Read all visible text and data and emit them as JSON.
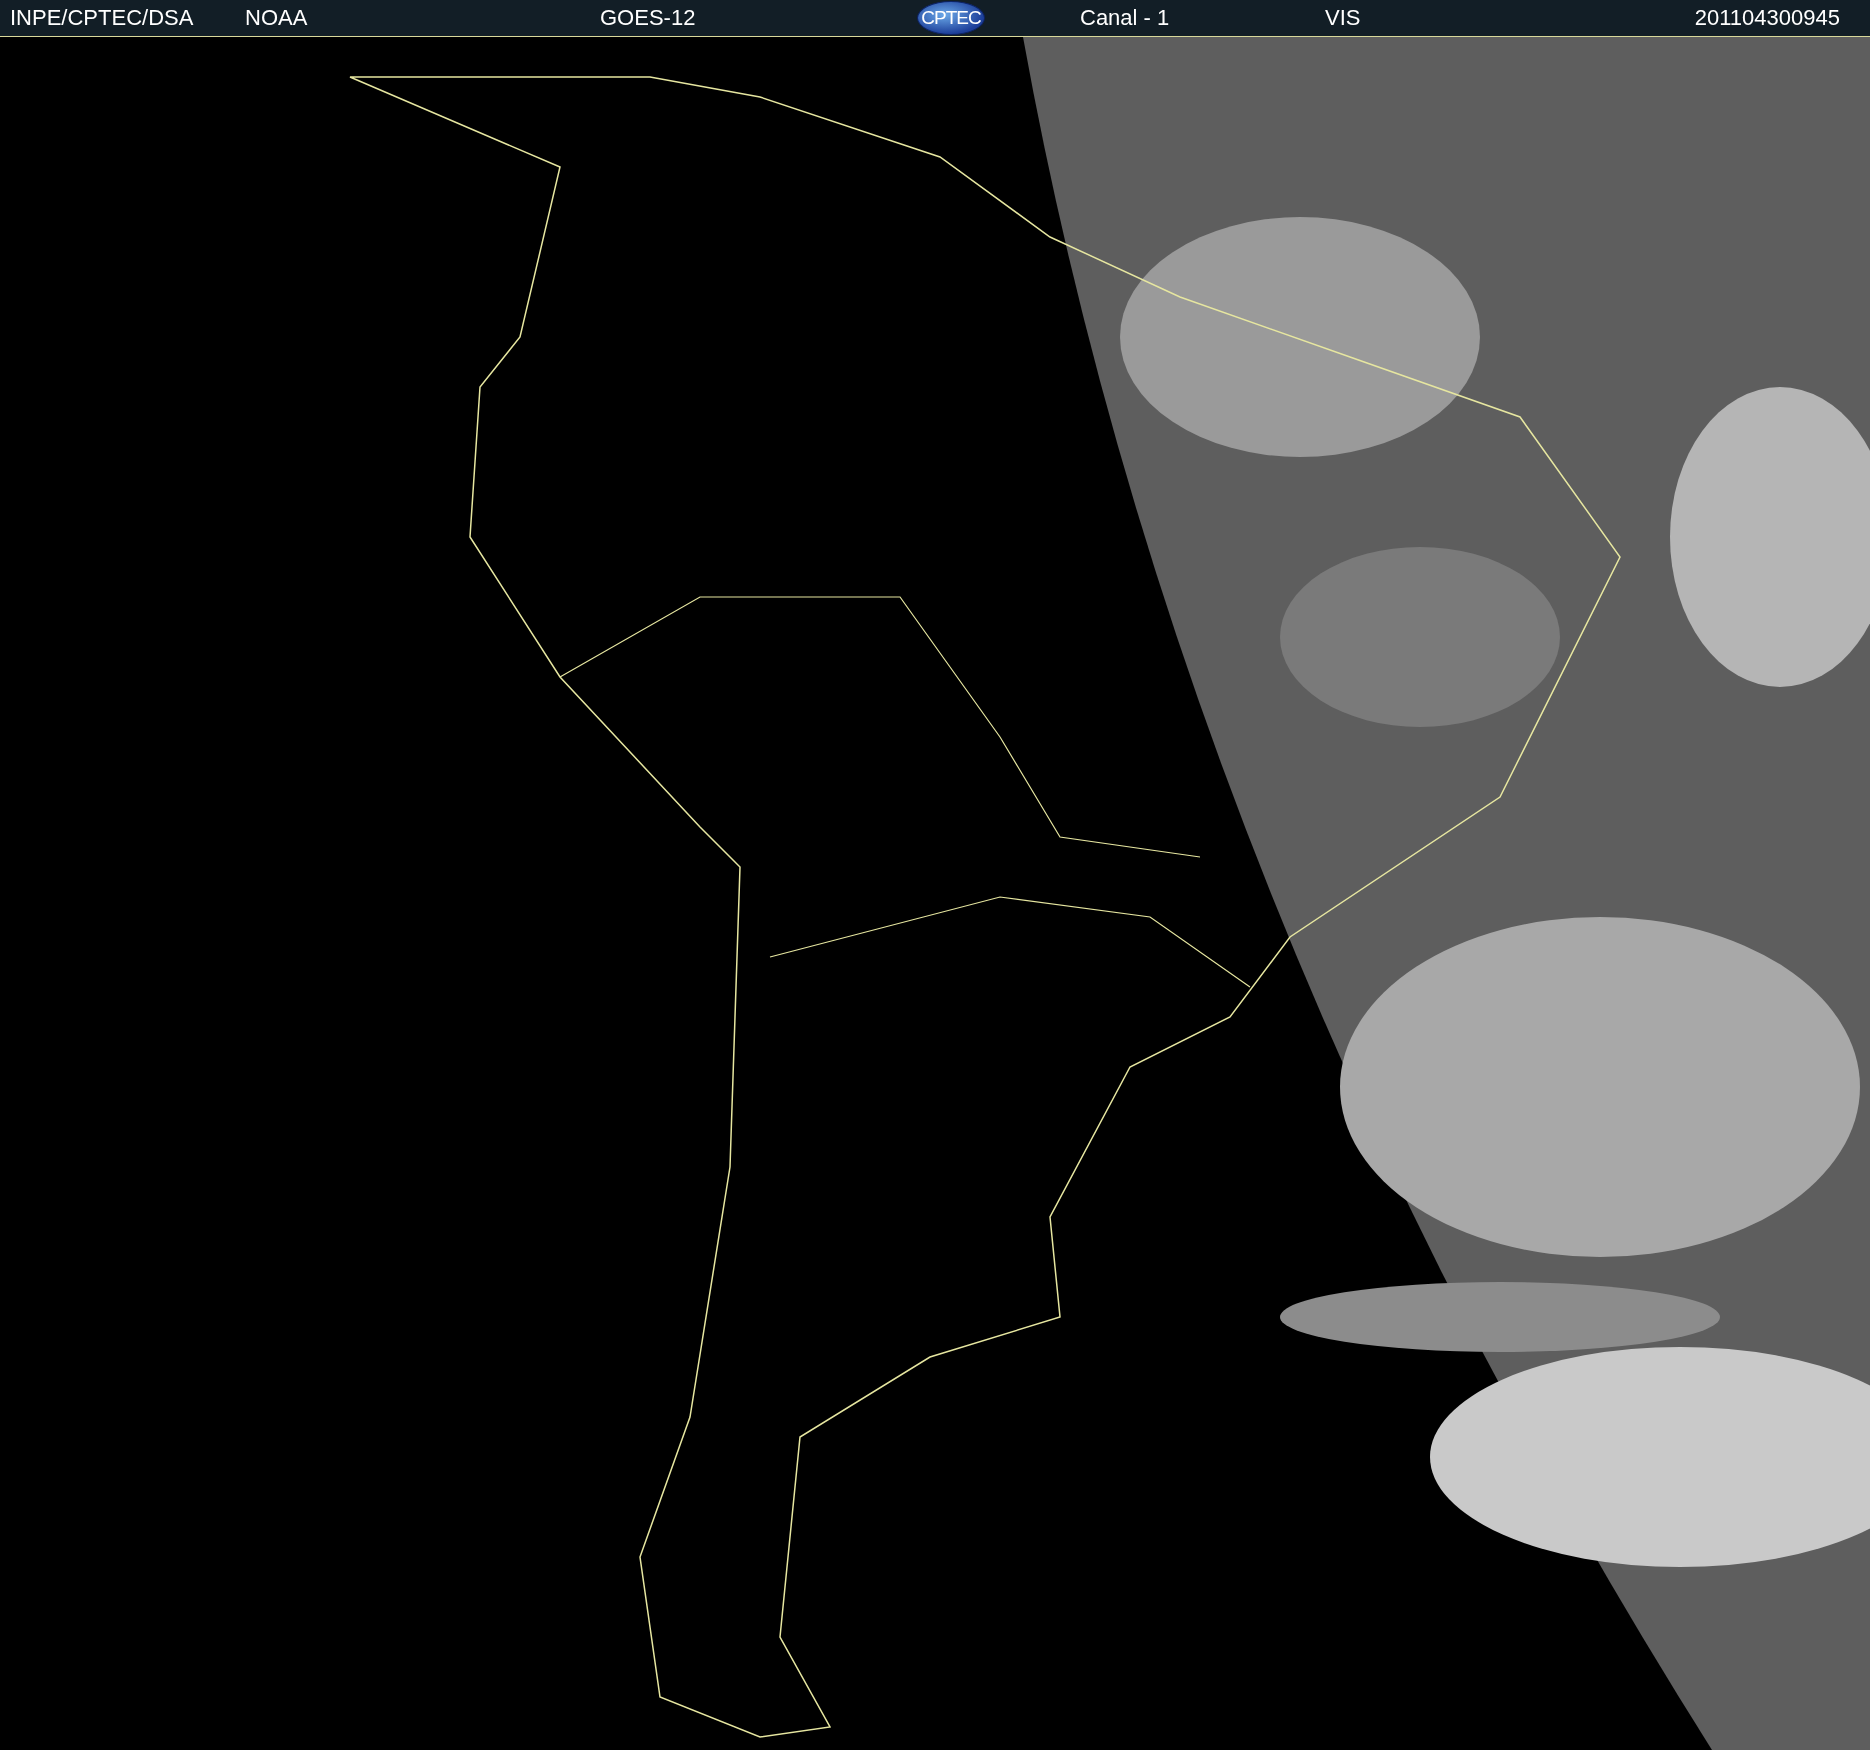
{
  "header": {
    "items": [
      {
        "kind": "text",
        "text": "INPE/CPTEC/DSA"
      },
      {
        "kind": "text",
        "text": "NOAA"
      },
      {
        "kind": "text",
        "text": "GOES-12"
      },
      {
        "kind": "logo",
        "text": "CPTEC"
      },
      {
        "kind": "text",
        "text": "Canal - 1"
      },
      {
        "kind": "text",
        "text": "VIS"
      },
      {
        "kind": "text",
        "text": "201104300945"
      }
    ]
  }
}
